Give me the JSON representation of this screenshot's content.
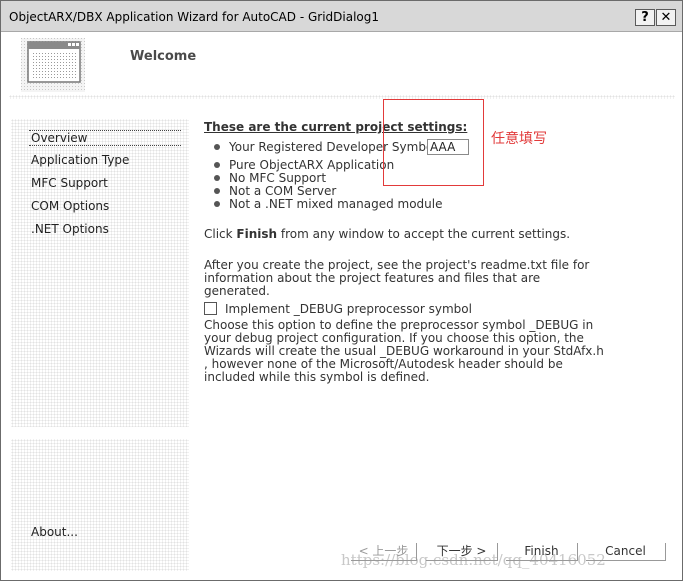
{
  "window": {
    "title": "ObjectARX/DBX Application Wizard for AutoCAD - GridDialog1",
    "help_label": "?",
    "close_label": "✕"
  },
  "header": {
    "title": "Welcome"
  },
  "sidebar": {
    "items": [
      {
        "label": "Overview"
      },
      {
        "label": "Application Type"
      },
      {
        "label": "MFC Support"
      },
      {
        "label": "COM Options"
      },
      {
        "label": ".NET Options"
      }
    ],
    "about": "About..."
  },
  "main": {
    "settings_heading": "These are the current project settings:",
    "bullets": [
      {
        "label": "Your Registered Developer Symbol:"
      },
      {
        "label": "Pure ObjectARX Application"
      },
      {
        "label": "No MFC Support"
      },
      {
        "label": "Not a COM Server"
      },
      {
        "label": "Not a .NET mixed managed module"
      }
    ],
    "symbol_value": "AAA",
    "annotation": "任意填写",
    "finish_pre": "Click ",
    "finish_bold": "Finish",
    "finish_post": " from any window to accept the current settings.",
    "after_text": "After you create the project, see the project's readme.txt file for information about the project features and files that are generated.",
    "debug_checkbox_label": "Implement _DEBUG preprocessor symbol",
    "debug_checked": false,
    "debug_desc": "Choose this option to define the preprocessor symbol _DEBUG in your debug project configuration. If you choose this option, the Wizards will create the usual _DEBUG workaround in your StdAfx.h , however none of the Microsoft/Autodesk header should be included while this symbol is defined."
  },
  "buttons": {
    "prev": "< 上一步",
    "next": "下一步 >",
    "finish": "Finish",
    "cancel": "Cancel"
  },
  "watermark": "https://blog.csdn.net/qq_40416052",
  "colors": {
    "annotation": "#e23a3a",
    "titlebar": "#d8d8d8"
  }
}
